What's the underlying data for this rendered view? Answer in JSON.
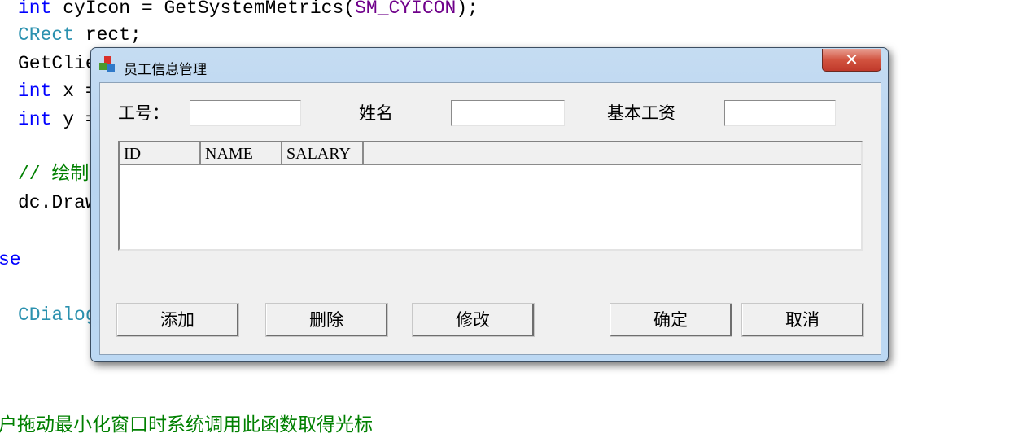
{
  "code_background": {
    "lines": [
      {
        "parts": [
          [
            "kw",
            "int"
          ],
          [
            "tx",
            " cyIcon = GetSystemMetrics("
          ],
          [
            "mac",
            "SM_CYICON"
          ],
          [
            "tx",
            ");"
          ]
        ]
      },
      {
        "parts": [
          [
            "ty",
            "CRect"
          ],
          [
            "tx",
            " rect;"
          ]
        ]
      },
      {
        "parts": [
          [
            "tx",
            "GetClie"
          ]
        ]
      },
      {
        "parts": [
          [
            "kw",
            "int"
          ],
          [
            "tx",
            " x ="
          ]
        ]
      },
      {
        "parts": [
          [
            "kw",
            "int"
          ],
          [
            "tx",
            " y ="
          ]
        ]
      },
      {
        "parts": [
          [
            "cm",
            "// 绘制"
          ]
        ]
      },
      {
        "parts": [
          [
            "tx",
            "dc.Draw"
          ]
        ]
      },
      {
        "parts": [
          [
            "kw",
            "se"
          ]
        ]
      },
      {
        "parts": [
          [
            "ty",
            "CDialog"
          ]
        ]
      },
      {
        "parts": [
          [
            "cm",
            "户拖动最小化窗口时系统调用此函数取得光标"
          ]
        ]
      }
    ]
  },
  "dialog": {
    "title": "员工信息管理",
    "icon": "mfc-app-icon",
    "close_label": "✕",
    "fields": [
      {
        "label": "工号：",
        "value": ""
      },
      {
        "label": "姓名",
        "value": ""
      },
      {
        "label": "基本工资",
        "value": ""
      }
    ],
    "list": {
      "columns": [
        "ID",
        "NAME",
        "SALARY"
      ],
      "rows": []
    },
    "buttons": {
      "add": "添加",
      "delete": "删除",
      "modify": "修改",
      "ok": "确定",
      "cancel": "取消"
    }
  }
}
